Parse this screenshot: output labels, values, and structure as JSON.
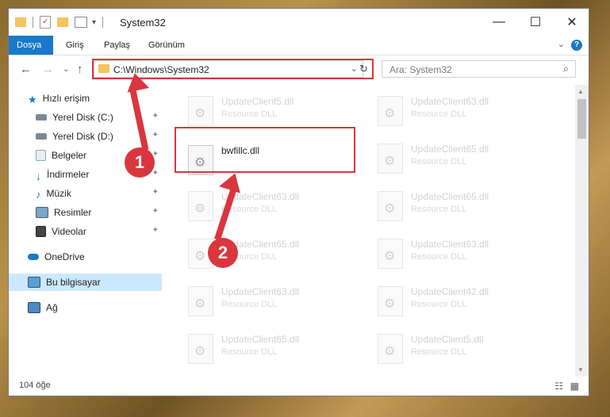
{
  "window": {
    "title": "System32",
    "controls": {
      "minimize": "—",
      "maximize": "☐",
      "close": "✕"
    }
  },
  "ribbon": {
    "tabs": [
      {
        "label": "Dosya",
        "active": true
      },
      {
        "label": "Giriş",
        "active": false
      },
      {
        "label": "Paylaş",
        "active": false
      },
      {
        "label": "Görünüm",
        "active": false
      }
    ],
    "help": "?",
    "expand": "⌄"
  },
  "nav": {
    "back": "←",
    "forward": "→",
    "recent": "⌄",
    "up": "↑",
    "address": "C:\\Windows\\System32",
    "address_dropdown": "⌄",
    "refresh": "↻",
    "search_placeholder": "Ara: System32",
    "search_icon": "⌕"
  },
  "sidebar": {
    "items": [
      {
        "label": "Hızlı erişim",
        "icon": "star-icon",
        "pinned": false
      },
      {
        "label": "Yerel Disk (C:)",
        "icon": "drive-icon",
        "pinned": true
      },
      {
        "label": "Yerel Disk (D:)",
        "icon": "drive-icon",
        "pinned": true
      },
      {
        "label": "Belgeler",
        "icon": "documents-icon",
        "pinned": true
      },
      {
        "label": "İndirmeler",
        "icon": "download-icon",
        "pinned": true
      },
      {
        "label": "Müzik",
        "icon": "music-icon",
        "pinned": true
      },
      {
        "label": "Resimler",
        "icon": "pictures-icon",
        "pinned": true
      },
      {
        "label": "Videolar",
        "icon": "video-icon",
        "pinned": true
      },
      {
        "label": "OneDrive",
        "icon": "cloud-icon",
        "pinned": false
      },
      {
        "label": "Bu bilgisayar",
        "icon": "computer-icon",
        "pinned": false,
        "selected": true
      },
      {
        "label": "Ağ",
        "icon": "network-icon",
        "pinned": false
      }
    ],
    "pin_glyph": "📌"
  },
  "files": {
    "left": [
      {
        "name": "UpdateClient5.dll",
        "type": "Resource DLL"
      },
      {
        "name": "bwfillc.dll",
        "type": ""
      },
      {
        "name": "UpdateClient63.dll",
        "type": "Resource DLL"
      },
      {
        "name": "UpdateClient65.dll",
        "type": "Resource DLL"
      },
      {
        "name": "UpdateClient63.dll",
        "type": "Resource DLL"
      },
      {
        "name": "UpdateClient65.dll",
        "type": "Resource DLL"
      }
    ],
    "right": [
      {
        "name": "UpdateClient63.dll",
        "type": "Resource DLL"
      },
      {
        "name": "UpdateClient65.dll",
        "type": "Resource DLL"
      },
      {
        "name": "UpdateClient65.dll",
        "type": "Resource DLL"
      },
      {
        "name": "UpdateClient63.dll",
        "type": "Resource DLL"
      },
      {
        "name": "UpdateClient42.dll",
        "type": "Resource DLL"
      },
      {
        "name": "UpdateClient5.dll",
        "type": "Resource DLL"
      }
    ]
  },
  "annotations": {
    "step1": "1",
    "step2": "2"
  },
  "status": {
    "count": "104 öğe",
    "view_details": "☷",
    "view_icons": "▦"
  },
  "colors": {
    "accent": "#1979ca",
    "highlight": "#d9363e",
    "selected": "#cce8ff"
  }
}
